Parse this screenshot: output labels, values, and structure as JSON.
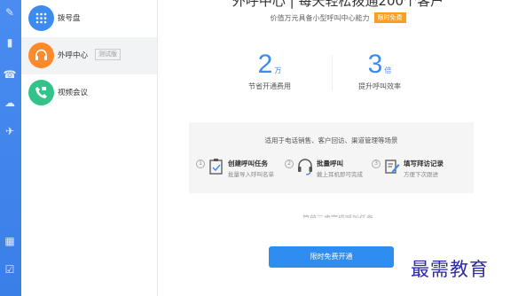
{
  "sidebar": {
    "items": [
      {
        "label": "拨号盘",
        "icon": "keypad-icon",
        "color": "#3c8cf0"
      },
      {
        "label": "外呼中心",
        "icon": "headset-icon",
        "color": "#ff8a2b",
        "tag": "测试版"
      },
      {
        "label": "视频会议",
        "icon": "phone-video-icon",
        "color": "#33c38a"
      }
    ]
  },
  "main": {
    "headline": "外呼中心 | 每天轻松拨通200个客户",
    "subline": "价值万元具备小型呼叫中心能力",
    "badge": "限时免费",
    "stats": [
      {
        "num": "2",
        "unit": "万",
        "desc": "节省开通费用"
      },
      {
        "num": "3",
        "unit": "倍",
        "desc": "提升呼叫效率"
      }
    ],
    "panel_title": "适用于电话销售、客户回访、渠道管理等场景",
    "steps": [
      {
        "idx": "1",
        "title": "创建呼叫任务",
        "desc": "批量导入呼叫名单"
      },
      {
        "idx": "2",
        "title": "批量呼叫",
        "desc": "戴上耳机即可完成"
      },
      {
        "idx": "3",
        "title": "填写拜访记录",
        "desc": "方便下次跟进"
      }
    ],
    "cut_text": "简单三步完成呼叫任务",
    "cta": "限时免费开通"
  },
  "watermark": "最需教育",
  "colors": {
    "accent": "#2f8cf0",
    "rail": "#3a7ee8",
    "badge": "#ff9d1f"
  }
}
